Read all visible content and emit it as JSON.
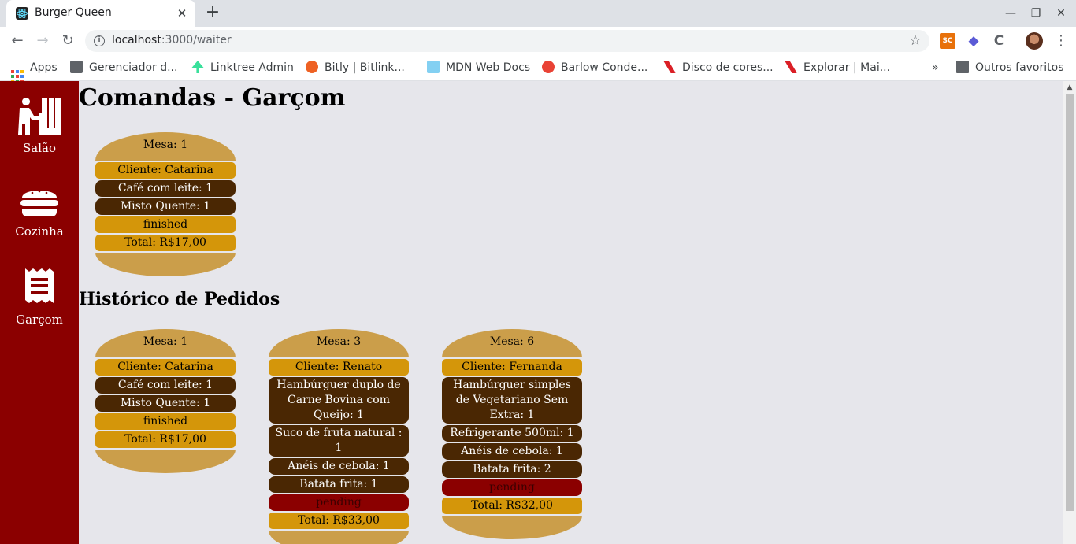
{
  "browser": {
    "tab_title": "Burger Queen",
    "url_host": "localhost",
    "url_rest": ":3000/waiter",
    "bookmarks": [
      {
        "label": "Apps",
        "color": "#4285f4"
      },
      {
        "label": "Gerenciador d...",
        "color": "#5f6368"
      },
      {
        "label": "Linktree Admin",
        "color": "#39e09b"
      },
      {
        "label": "Bitly | Bitlink...",
        "color": "#ee6123"
      },
      {
        "label": "MDN Web Docs",
        "color": "#83d0f2"
      },
      {
        "label": "Barlow Conde...",
        "color": "#e94235"
      },
      {
        "label": "Disco de cores...",
        "color": "#da1f26"
      },
      {
        "label": "Explorar | Mai...",
        "color": "#da1f26"
      }
    ],
    "more_bookmarks": "»",
    "other_bookmarks": "Outros favoritos",
    "extension_sc": "SC"
  },
  "sidebar": {
    "items": [
      {
        "label": "Salão",
        "icon": "waiter-table-icon"
      },
      {
        "label": "Cozinha",
        "icon": "burger-icon"
      },
      {
        "label": "Garçom",
        "icon": "receipt-icon"
      }
    ]
  },
  "page": {
    "title": "Comandas - Garçom",
    "history_title": "Histórico de Pedidos"
  },
  "active_orders": [
    {
      "table": "Mesa: 1",
      "client": "Cliente: Catarina",
      "items": [
        "Café com leite: 1",
        "Misto Quente: 1"
      ],
      "status": "finished",
      "total": "Total: R$17,00"
    }
  ],
  "history_orders": [
    {
      "table": "Mesa: 1",
      "client": "Cliente: Catarina",
      "items": [
        "Café com leite: 1",
        "Misto Quente: 1"
      ],
      "status": "finished",
      "total": "Total: R$17,00"
    },
    {
      "table": "Mesa: 3",
      "client": "Cliente: Renato",
      "items": [
        "Hambúrguer duplo de Carne Bovina com Queijo: 1",
        "Suco de fruta natural : 1",
        "Anéis de cebola: 1",
        "Batata frita: 1"
      ],
      "status": "pending",
      "total": "Total: R$33,00"
    },
    {
      "table": "Mesa: 6",
      "client": "Cliente: Fernanda",
      "items": [
        "Hambúrguer simples de Vegetariano Sem Extra: 1",
        "Refrigerante 500ml: 1",
        "Anéis de cebola: 1",
        "Batata frita: 2"
      ],
      "status": "pending",
      "total": "Total: R$32,00"
    }
  ],
  "colors": {
    "sidebar": "#8b0000",
    "bun": "#cb9e4a",
    "cheese": "#d4960a",
    "patty": "#4a2703",
    "pending": "#8b0000"
  }
}
